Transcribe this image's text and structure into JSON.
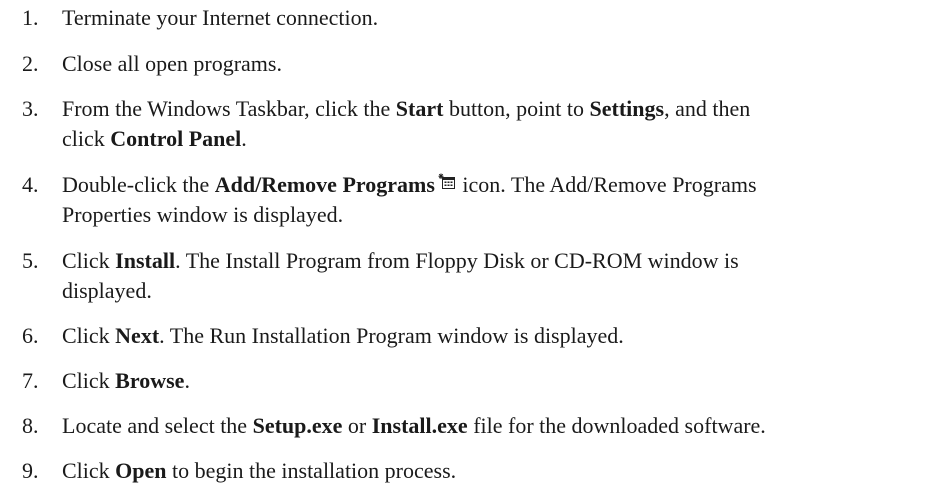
{
  "steps": [
    {
      "number": "1.",
      "text": "Terminate your Internet connection."
    },
    {
      "number": "2.",
      "text": "Close all open programs."
    },
    {
      "number": "3.",
      "t1": "From the Windows Taskbar, click the ",
      "b1": "Start",
      "t2": " button, point to ",
      "b2": "Settings",
      "t3": ", and then",
      "t4": "click ",
      "b3": "Control Panel",
      "t5": "."
    },
    {
      "number": "4.",
      "t1": "Double-click the ",
      "b1": "Add/Remove Programs",
      "icon": "add-remove-programs-icon",
      "t2": " icon. The Add/Remove Programs",
      "t3": "Properties window is displayed."
    },
    {
      "number": "5.",
      "t1": "Click ",
      "b1": "Install",
      "t2": ". The Install Program from Floppy Disk or CD-ROM window is",
      "t3": "displayed."
    },
    {
      "number": "6.",
      "t1": "Click ",
      "b1": "Next",
      "t2": ". The Run Installation Program window is displayed."
    },
    {
      "number": "7.",
      "t1": "Click ",
      "b1": "Browse",
      "t2": "."
    },
    {
      "number": "8.",
      "t1": "Locate and select the ",
      "b1": "Setup.exe",
      "t2": " or ",
      "b2": "Install.exe",
      "t3": " file for the downloaded software."
    },
    {
      "number": "9.",
      "t1": "Click ",
      "b1": "Open",
      "t2": " to begin the installation process."
    }
  ]
}
